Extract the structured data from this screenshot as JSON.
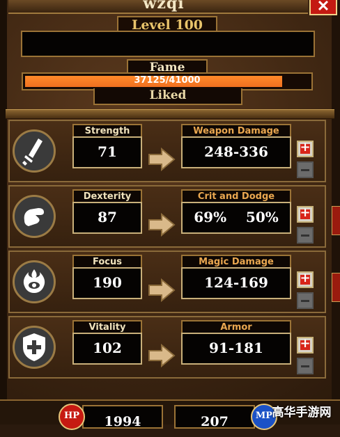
{
  "header": {
    "player_name": "wzqi",
    "close_label": "✕",
    "level": "Level 100"
  },
  "fame": {
    "label": "Fame",
    "progress_text": "37125/41000",
    "progress_fraction": 0.9055,
    "status": "Liked"
  },
  "stats": [
    {
      "stat_label": "Strength",
      "stat_value": "71",
      "result_label": "Weapon Damage",
      "result_value": "248-336",
      "icon": "sword-icon",
      "plus": "+"
    },
    {
      "stat_label": "Dexterity",
      "stat_value": "87",
      "result_label": "Crit and Dodge",
      "result_value": "69%    50%",
      "icon": "fist-icon",
      "plus": "+"
    },
    {
      "stat_label": "Focus",
      "stat_value": "190",
      "result_label": "Magic Damage",
      "result_value": "124-169",
      "icon": "eye-flame-icon",
      "plus": "+"
    },
    {
      "stat_label": "Vitality",
      "stat_value": "102",
      "result_label": "Armor",
      "result_value": "91-181",
      "icon": "shield-icon",
      "plus": "+"
    }
  ],
  "footer": {
    "hp_label": "HP",
    "hp_value": "1994",
    "mp_label": "MP",
    "mp_value": "207"
  },
  "watermark": "高华手游网",
  "colors": {
    "fame_fill": "#f07020",
    "panel_brown": "#3e2612",
    "gold_border": "#9b7336",
    "plus_red": "#d8251a"
  }
}
